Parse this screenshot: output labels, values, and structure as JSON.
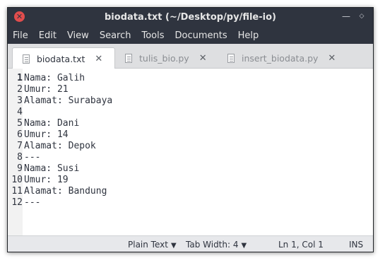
{
  "window": {
    "title": "biodata.txt (~/Desktop/py/file-io)",
    "close_glyph": "✕",
    "min_glyph": "—",
    "max_glyph": "◇"
  },
  "menu": [
    "File",
    "Edit",
    "View",
    "Search",
    "Tools",
    "Documents",
    "Help"
  ],
  "tabs": [
    {
      "label": "biodata.txt",
      "active": true
    },
    {
      "label": "tulis_bio.py",
      "active": false
    },
    {
      "label": "insert_biodata.py",
      "active": false
    }
  ],
  "tab_close_glyph": "✕",
  "editor": {
    "lines": [
      {
        "n": "1",
        "text": "Nama: Galih"
      },
      {
        "n": "2",
        "text": "Umur: 21"
      },
      {
        "n": "3",
        "text": "Alamat: Surabaya"
      },
      {
        "n": "4",
        "text": ""
      },
      {
        "n": "5",
        "text": "Nama: Dani"
      },
      {
        "n": "6",
        "text": "Umur: 14"
      },
      {
        "n": "7",
        "text": "Alamat: Depok"
      },
      {
        "n": "8",
        "text": "---"
      },
      {
        "n": "9",
        "text": "Nama: Susi"
      },
      {
        "n": "10",
        "text": "Umur: 19"
      },
      {
        "n": "11",
        "text": "Alamat: Bandung"
      },
      {
        "n": "12",
        "text": "---"
      }
    ],
    "current_line": 1
  },
  "status": {
    "language": "Plain Text",
    "tab_width_label": "Tab Width:",
    "tab_width_value": "4",
    "position": "Ln 1, Col 1",
    "mode": "INS",
    "chevron": "▼"
  },
  "colors": {
    "titlebar_bg": "#2f343f",
    "close_button": "#e14d4d",
    "editor_bg": "#ffffff",
    "statusbar_bg": "#e7e8eb"
  },
  "icons": {
    "close": "close-icon",
    "minimize": "minimize-icon",
    "maximize": "maximize-icon",
    "file": "text-file-icon",
    "chevron": "chevron-down-icon"
  }
}
